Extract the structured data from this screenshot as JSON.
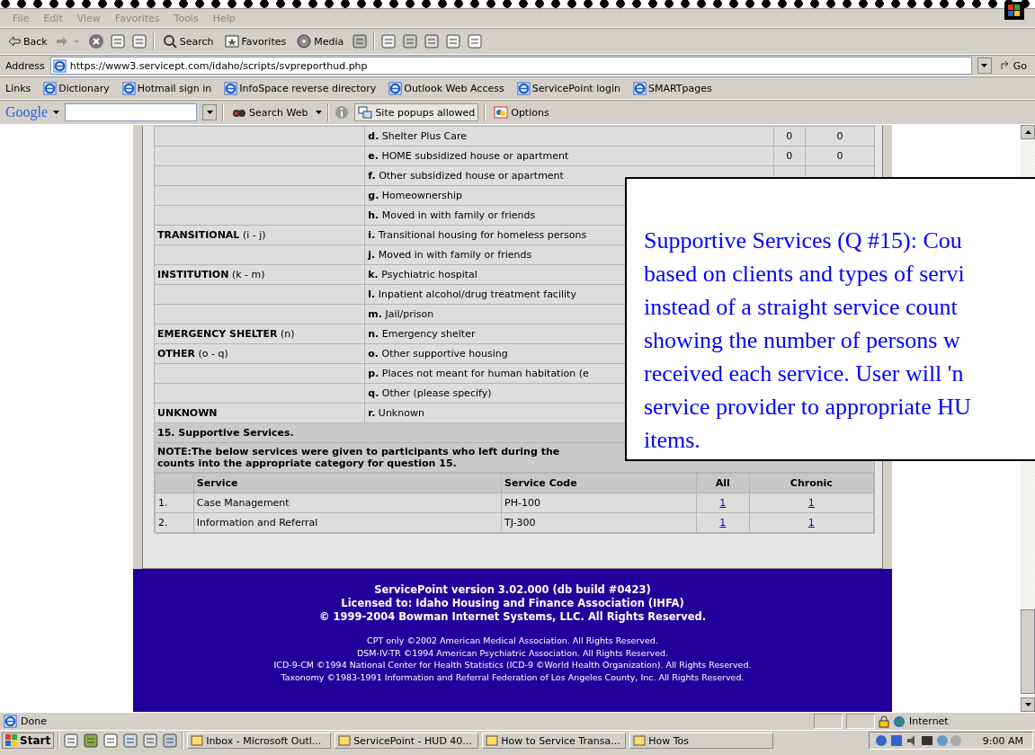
{
  "menu": [
    "File",
    "Edit",
    "View",
    "Favorites",
    "Tools",
    "Help"
  ],
  "toolbar": {
    "back": "Back",
    "search": "Search",
    "favorites": "Favorites",
    "media": "Media"
  },
  "address": {
    "label": "Address",
    "url": "https://www3.servicept.com/idaho/scripts/svpreporthud.php",
    "go": "Go"
  },
  "links": {
    "label": "Links",
    "items": [
      "Dictionary",
      "Hotmail sign in",
      "InfoSpace reverse directory",
      "Outlook Web Access",
      "ServicePoint login",
      "SMARTpages"
    ]
  },
  "google_bar": {
    "logo": "Google",
    "search_web": "Search Web",
    "popups": "Site popups allowed",
    "options": "Options"
  },
  "destination_rows": [
    {
      "category": "",
      "item": "**d.** Shelter Plus Care",
      "all": "0",
      "chronic": "0"
    },
    {
      "category": "",
      "item": "**e.** HOME subsidized house or apartment",
      "all": "0",
      "chronic": "0"
    },
    {
      "category": "",
      "item": "**f.** Other subsidized house or apartment"
    },
    {
      "category": "",
      "item": "**g.** Homeownership"
    },
    {
      "category": "",
      "item": "**h.** Moved in with family or friends"
    },
    {
      "category": "**TRANSITIONAL** (i - j)",
      "item": "**i.** Transitional housing for homeless persons"
    },
    {
      "category": "",
      "item": "**j.** Moved in with family or friends"
    },
    {
      "category": "**INSTITUTION** (k - m)",
      "item": "**k.** Psychiatric hospital"
    },
    {
      "category": "",
      "item": "**l.** Inpatient alcohol/drug treatment facility"
    },
    {
      "category": "",
      "item": "**m.** Jail/prison"
    },
    {
      "category": "**EMERGENCY SHELTER** (n)",
      "item": "**n.** Emergency shelter"
    },
    {
      "category": "**OTHER** (o - q)",
      "item": "**o.** Other supportive housing"
    },
    {
      "category": "",
      "item": "**p.** Places not meant for human habitation (e"
    },
    {
      "category": "",
      "item": "**q.** Other (please specify)"
    },
    {
      "category": "**UNKNOWN**",
      "item": "**r.** Unknown"
    }
  ],
  "supportive_services": {
    "heading": "15. Supportive Services.",
    "note_lines": [
      "NOTE:The below services were given to participants who left during the",
      "counts into the appropriate category for question 15."
    ],
    "columns": [
      "Service",
      "Service Code",
      "All",
      "Chronic"
    ],
    "rows": [
      {
        "number": "1.",
        "service": "Case Management",
        "code": "PH-100",
        "all": "1",
        "chronic": "1"
      },
      {
        "number": "2.",
        "service": "Information and Referral",
        "code": "TJ-300",
        "all": "1",
        "chronic": "1"
      }
    ]
  },
  "footer": {
    "lines": [
      "ServicePoint version 3.02.000 (db build #0423)",
      "Licensed to: Idaho Housing and Finance Association (IHFA)",
      "© 1999-2004 Bowman Internet Systems, LLC. All Rights Reserved."
    ],
    "notices": [
      "CPT only ©2002 American Medical Association. All Rights Reserved.",
      "DSM-IV-TR ©1994 American Psychiatric Association. All Rights Reserved.",
      "ICD-9-CM ©1994 National Center for Health Statistics (ICD-9 ©World Health Organization). All Rights Reserved.",
      "Taxonomy ©1983-1991 Information and Referral Federation of Los Angeles County, Inc. All Rights Reserved."
    ]
  },
  "callout": {
    "lines": [
      "Supportive Services (Q #15): Cou",
      "based on clients and types of servi",
      "instead of a straight service count",
      "showing the number of persons w",
      "received each service. User will 'n",
      "service provider to appropriate HU",
      "items."
    ]
  },
  "status_bar": {
    "text": "Done",
    "zone": "Internet"
  },
  "taskbar": {
    "start": "Start",
    "tasks": [
      "Inbox - Microsoft Outl...",
      "ServicePoint - HUD 40...",
      "How to Service Transa...",
      "How Tos"
    ],
    "clock": "9:00 AM"
  }
}
